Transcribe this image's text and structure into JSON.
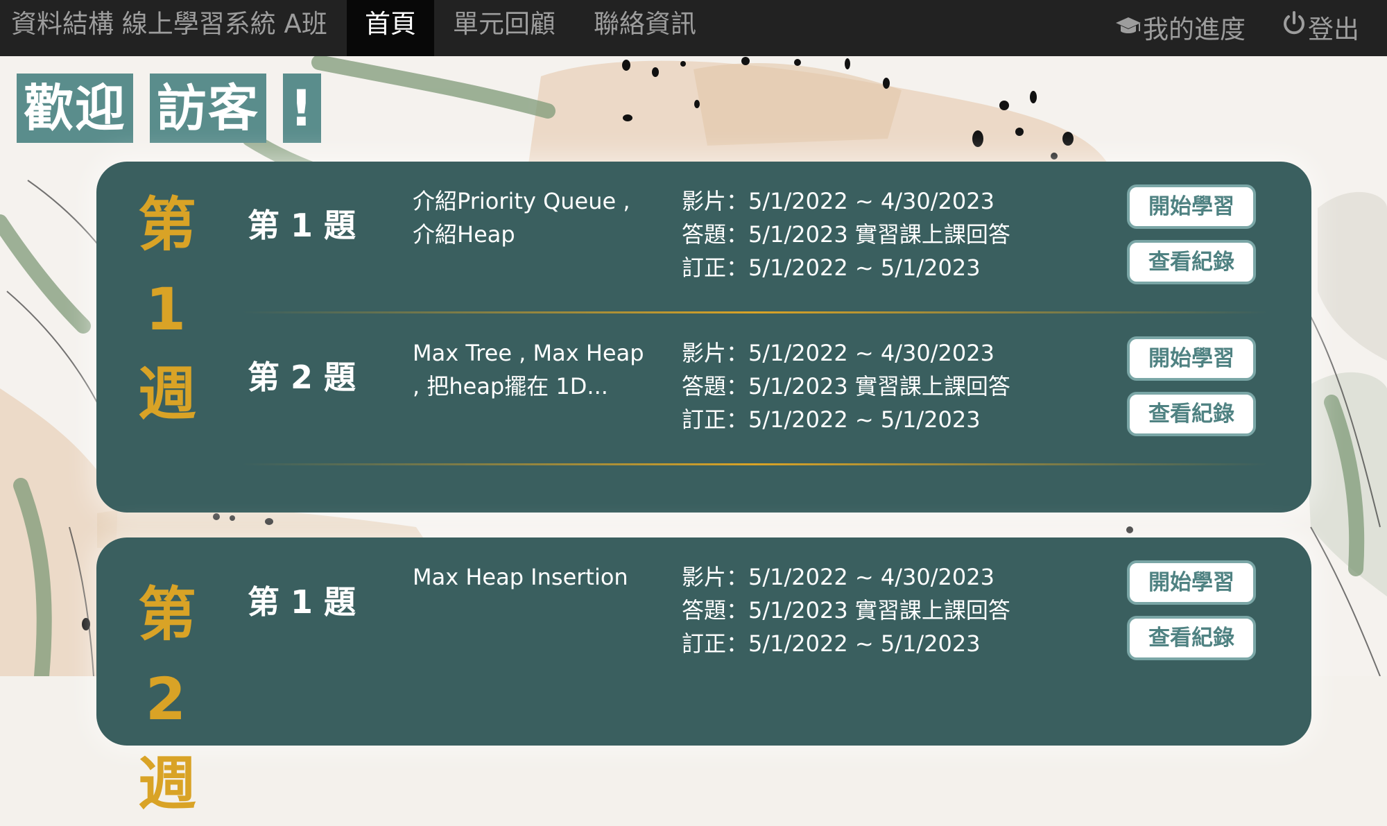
{
  "navbar": {
    "brand": "資料結構 線上學習系統 A班",
    "home": "首頁",
    "review": "單元回顧",
    "contact": "聯絡資訊",
    "progress": "我的進度",
    "progress_icon": "graduation-cap-icon",
    "logout": "登出",
    "logout_icon": "power-icon"
  },
  "welcome": {
    "part1": "歡迎",
    "part2": "訪客",
    "part3": "!"
  },
  "colors": {
    "navbar_bg": "#222222",
    "card_bg": "#3a5f5f",
    "week_label": "#d9a326",
    "welcome_bg": "#5a8d8c",
    "button_text": "#4f8282"
  },
  "weeks": [
    {
      "label_chars": [
        "第",
        "1",
        "週"
      ],
      "topics": [
        {
          "title": "第 1 題",
          "desc_line1": "介紹Priority Queue ,",
          "desc_line2": "介紹Heap",
          "video": "影片：5/1/2022 ~ 4/30/2023",
          "quiz": "答題：5/1/2023 實習課上課回答",
          "correction": "訂正：5/1/2022 ~ 5/1/2023",
          "start_button": "開始學習",
          "record_button": "查看紀錄"
        },
        {
          "title": "第 2 題",
          "desc_line1": "Max Tree , Max Heap",
          "desc_line2": ", 把heap擺在 1D...",
          "video": "影片：5/1/2022 ~ 4/30/2023",
          "quiz": "答題：5/1/2023 實習課上課回答",
          "correction": "訂正：5/1/2022 ~ 5/1/2023",
          "start_button": "開始學習",
          "record_button": "查看紀錄"
        }
      ]
    },
    {
      "label_chars": [
        "第",
        "2",
        "週"
      ],
      "topics": [
        {
          "title": "第 1 題",
          "desc_line1": "Max Heap Insertion",
          "desc_line2": "",
          "video": "影片：5/1/2022 ~ 4/30/2023",
          "quiz": "答題：5/1/2023 實習課上課回答",
          "correction": "訂正：5/1/2022 ~ 5/1/2023",
          "start_button": "開始學習",
          "record_button": "查看紀錄"
        }
      ]
    }
  ]
}
